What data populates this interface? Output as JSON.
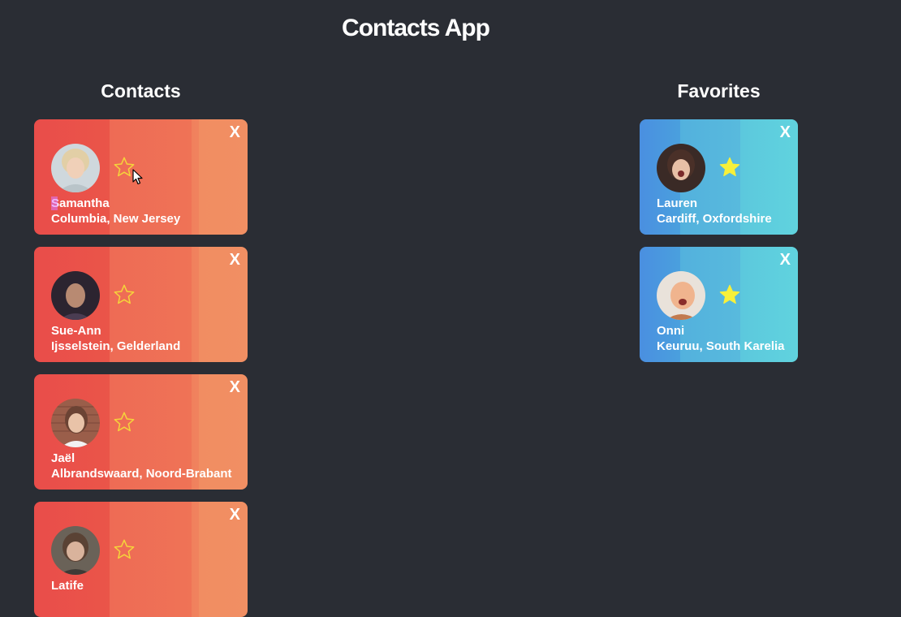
{
  "app": {
    "title": "Contacts App"
  },
  "contacts": {
    "heading": "Contacts",
    "items": [
      {
        "name": "Samantha",
        "location": "Columbia, New Jersey",
        "favorite": false,
        "star_icon": "star-outline-icon",
        "close_label": "X"
      },
      {
        "name": "Sue-Ann",
        "location": "Ijsselstein, Gelderland",
        "favorite": false,
        "star_icon": "star-outline-icon",
        "close_label": "X"
      },
      {
        "name": "Jaël",
        "location": "Albrandswaard, Noord-Brabant",
        "favorite": false,
        "star_icon": "star-outline-icon",
        "close_label": "X"
      },
      {
        "name": "Latife",
        "location": "",
        "favorite": false,
        "star_icon": "star-outline-icon",
        "close_label": "X"
      }
    ]
  },
  "favorites": {
    "heading": "Favorites",
    "items": [
      {
        "name": "Lauren",
        "location": "Cardiff, Oxfordshire",
        "favorite": true,
        "star_icon": "star-filled-icon",
        "close_label": "X"
      },
      {
        "name": "Onni",
        "location": "Keuruu, South Karelia",
        "favorite": true,
        "star_icon": "star-filled-icon",
        "close_label": "X"
      }
    ]
  },
  "colors": {
    "background": "#2a2d34",
    "contact_card": "#ee6b55",
    "favorite_card": "#53b1dd",
    "star_outline": "#f5d33b",
    "star_filled": "#f7f03a"
  }
}
